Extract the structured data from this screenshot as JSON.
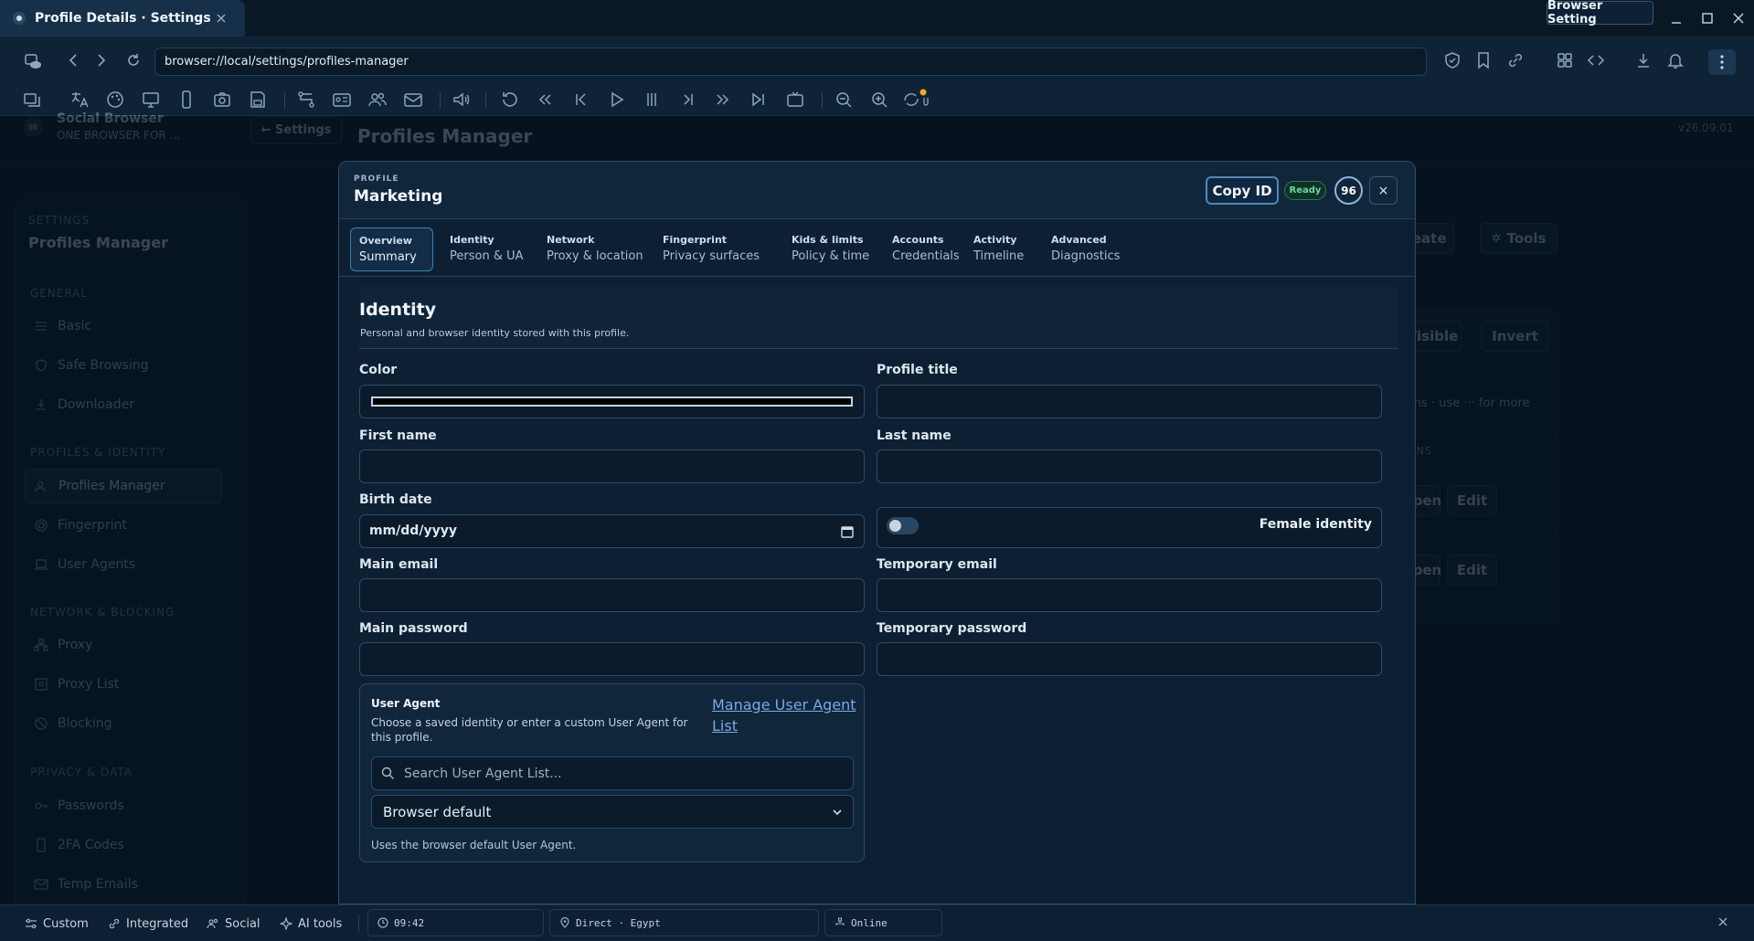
{
  "window": {
    "tab_title": "Profile Details · Settings",
    "browser_setting_label": "Browser Setting"
  },
  "address": {
    "url": "browser://local/settings/profiles-manager"
  },
  "background": {
    "brand_name": "Social Browser",
    "brand_tagline": "ONE BROWSER FOR ...",
    "back_label": "← Settings",
    "page_title": "Profiles Manager",
    "version": "v26.09.01",
    "sidebar": {
      "kicker": "SETTINGS",
      "title": "Profiles Manager",
      "sections": [
        {
          "title": "GENERAL",
          "items": [
            "Basic",
            "Safe Browsing",
            "Downloader"
          ]
        },
        {
          "title": "PROFILES & IDENTITY",
          "items": [
            "Profiles Manager",
            "Fingerprint",
            "User Agents"
          ]
        },
        {
          "title": "NETWORK & BLOCKING",
          "items": [
            "Proxy",
            "Proxy List",
            "Blocking"
          ]
        },
        {
          "title": "PRIVACY & DATA",
          "items": [
            "Passwords",
            "2FA Codes",
            "Temp Emails"
          ]
        }
      ]
    },
    "buttons": {
      "create": "Create",
      "tools": "Tools",
      "visible": "Visible",
      "invert": "Invert",
      "open": "Open",
      "edit": "Edit"
    },
    "hint": "actions · use ··· for more",
    "column_hint": "ONS"
  },
  "modal": {
    "kicker": "PROFILE",
    "title": "Marketing",
    "copy_id": "Copy ID",
    "status": "Ready",
    "score": "96",
    "close": "×",
    "tabs": [
      {
        "key": "Overview",
        "value": "Summary"
      },
      {
        "key": "Identity",
        "value": "Person & UA"
      },
      {
        "key": "Network",
        "value": "Proxy & location"
      },
      {
        "key": "Fingerprint",
        "value": "Privacy surfaces"
      },
      {
        "key": "Kids & limits",
        "value": "Policy & time"
      },
      {
        "key": "Accounts",
        "value": "Credentials"
      },
      {
        "key": "Activity",
        "value": "Timeline"
      },
      {
        "key": "Advanced",
        "value": "Diagnostics"
      }
    ],
    "section_title": "Identity",
    "section_subtitle": "Personal and browser identity stored with this profile.",
    "fields": {
      "color": "Color",
      "color_value": "#000000",
      "profile_title": "Profile title",
      "first_name": "First name",
      "last_name": "Last name",
      "birth_date": "Birth date",
      "birth_date_placeholder": "mm/dd/yyyy",
      "female_identity": "Female identity",
      "female_identity_on": false,
      "main_email": "Main email",
      "temporary_email": "Temporary email",
      "main_password": "Main password",
      "temporary_password": "Temporary password"
    },
    "user_agent": {
      "title": "User Agent",
      "description": "Choose a saved identity or enter a custom User Agent for this profile.",
      "link": "Manage User Agent List",
      "search_placeholder": "Search User Agent List...",
      "selected": "Browser default",
      "note": "Uses the browser default User Agent."
    }
  },
  "statusbar": {
    "custom": "Custom",
    "integrated": "Integrated",
    "social": "Social",
    "ai_tools": "AI tools",
    "time": "09:42",
    "route": "Direct · Egypt",
    "network": "Online"
  },
  "colors": {
    "accent": "#3c7fb8",
    "ready": "#67d9a0",
    "link": "#7ba8e0",
    "notification_dot": "#f5a623"
  }
}
